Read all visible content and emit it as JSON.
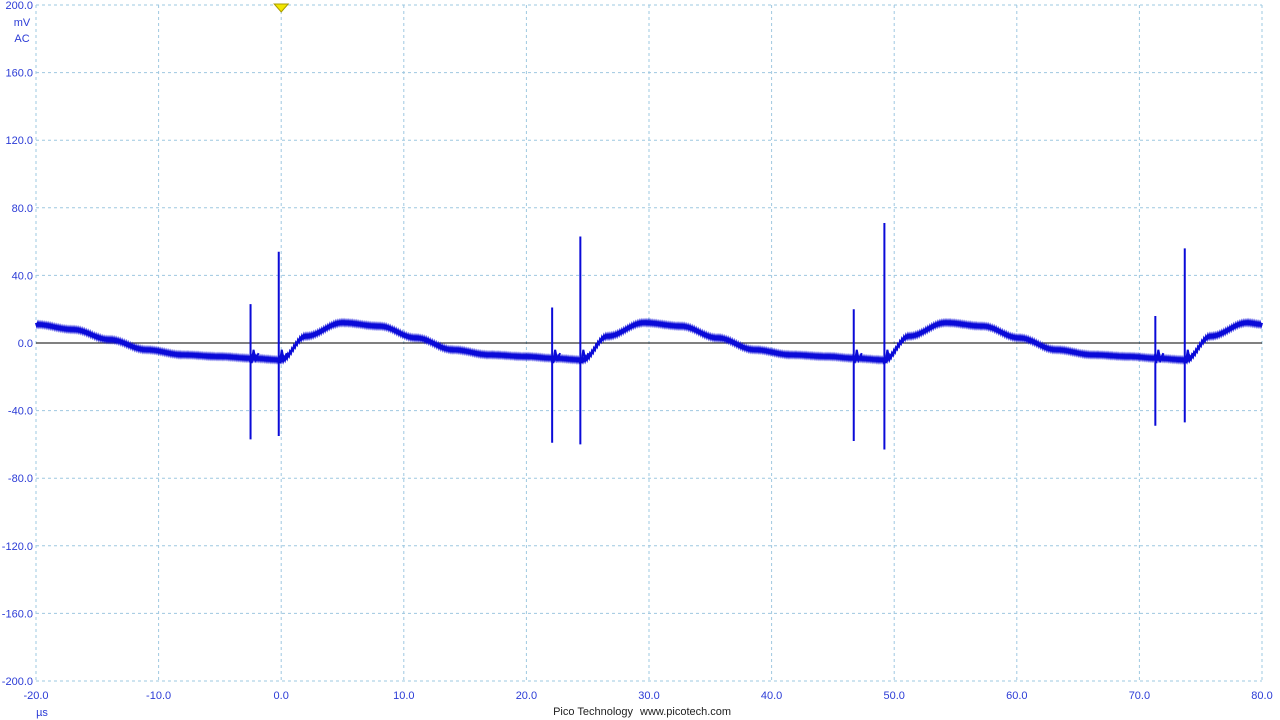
{
  "colors": {
    "trace": "#0a0ad8",
    "grid": "#9ec8e0",
    "axis_text": "#2b3bd6",
    "trigger": "#f2e600",
    "zero_line": "#000000"
  },
  "chart_data": {
    "type": "line",
    "channel": {
      "unit": "mV",
      "coupling": "AC"
    },
    "xlabel": "µs",
    "xlim": [
      -20,
      80
    ],
    "ylim": [
      -200,
      200
    ],
    "x_ticks": [
      "-20.0",
      "-10.0",
      "0.0",
      "10.0",
      "20.0",
      "30.0",
      "40.0",
      "50.0",
      "60.0",
      "70.0",
      "80.0"
    ],
    "y_ticks": [
      "200.0",
      "160.0",
      "120.0",
      "80.0",
      "40.0",
      "0.0",
      "-40.0",
      "-80.0",
      "-120.0",
      "-160.0",
      "-200.0"
    ],
    "grid": true,
    "trigger_x": 0,
    "period_us": 24.6,
    "series": [
      {
        "x": [
          -20,
          -17,
          -14,
          -11,
          -8,
          -5,
          -2.5,
          0,
          2,
          5,
          8,
          11,
          14,
          17,
          20,
          22.1,
          24.6,
          26.6,
          29.6,
          32.6,
          35.6,
          38.6,
          41.6,
          44.6,
          46.7,
          49.2,
          51.2,
          54.2,
          57.2,
          60.2,
          63.2,
          66.2,
          69.2,
          71.3,
          73.8,
          75.8,
          78.8,
          80
        ],
        "y": [
          11,
          8,
          2,
          -4,
          -7,
          -8,
          -9,
          -10,
          4,
          12,
          10,
          3,
          -4,
          -7,
          -8,
          -9,
          -10,
          4,
          12,
          10,
          3,
          -4,
          -7,
          -8,
          -9,
          -10,
          4,
          12,
          10,
          3,
          -4,
          -7,
          -8,
          -9,
          -10,
          4,
          12,
          11
        ]
      }
    ],
    "spikes": [
      {
        "x": -2.5,
        "max": 23,
        "min": -57
      },
      {
        "x": -0.2,
        "max": 54,
        "min": -55
      },
      {
        "x": 22.1,
        "max": 21,
        "min": -59
      },
      {
        "x": 24.4,
        "max": 63,
        "min": -60
      },
      {
        "x": 46.7,
        "max": 20,
        "min": -58
      },
      {
        "x": 49.2,
        "max": 71,
        "min": -63
      },
      {
        "x": 71.3,
        "max": 16,
        "min": -49
      },
      {
        "x": 73.7,
        "max": 56,
        "min": -47
      }
    ]
  },
  "footer": {
    "brand": "Pico Technology",
    "url": "www.picotech.com"
  }
}
